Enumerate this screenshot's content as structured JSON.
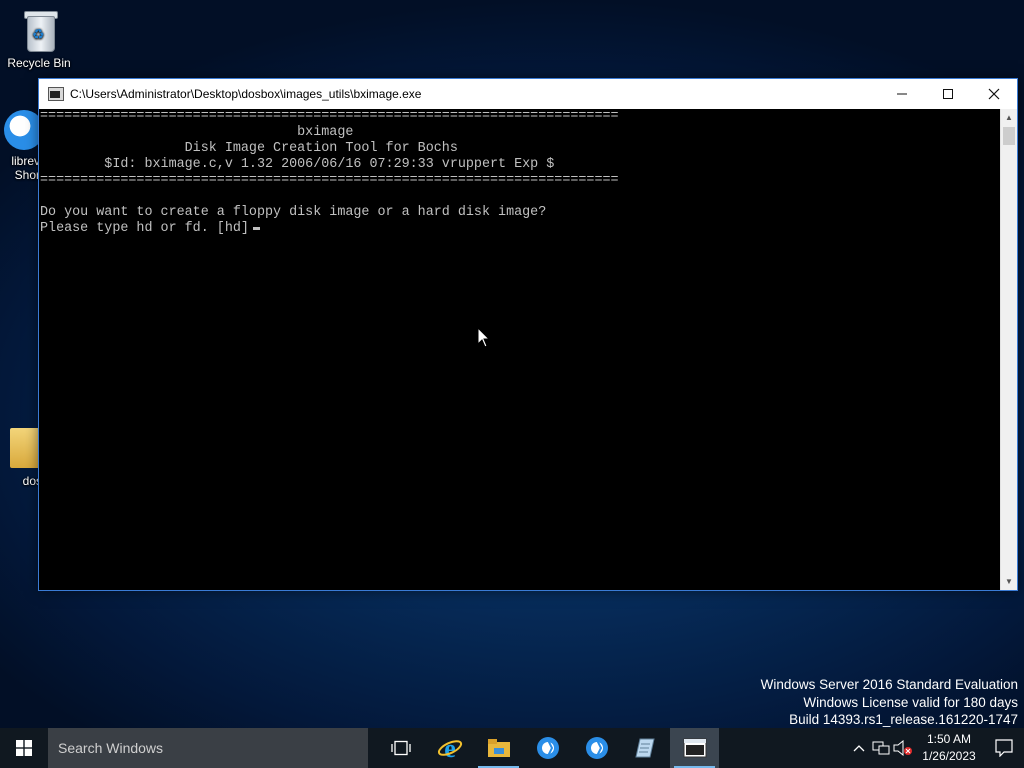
{
  "desktop": {
    "icons": [
      {
        "label": "Recycle Bin"
      },
      {
        "label_line1": "librev",
        "label_line2": "Shor"
      },
      {
        "label": "dos"
      }
    ]
  },
  "console": {
    "title": "C:\\Users\\Administrator\\Desktop\\dosbox\\images_utils\\bximage.exe",
    "output": "========================================================================\n                                bximage\n                  Disk Image Creation Tool for Bochs\n        $Id: bximage.c,v 1.32 2006/06/16 07:29:33 vruppert Exp $\n========================================================================\n\nDo you want to create a floppy disk image or a hard disk image?\nPlease type hd or fd. [hd]",
    "buttons": {
      "minimize": "minimize",
      "maximize": "maximize",
      "close": "close"
    }
  },
  "watermark": {
    "line1": "Windows Server 2016 Standard Evaluation",
    "line2": "Windows License valid for 180 days",
    "line3": "Build 14393.rs1_release.161220-1747"
  },
  "taskbar": {
    "search_placeholder": "Search Windows",
    "apps": [
      "task-view-icon",
      "internet-explorer-icon",
      "file-explorer-icon",
      "librewolf-icon",
      "librewolf-icon",
      "notepad-icon",
      "console-icon"
    ],
    "clock": {
      "time": "1:50 AM",
      "date": "1/26/2023"
    }
  },
  "colors": {
    "accent": "#3a7bd5",
    "console_bg": "#000000",
    "console_fg": "#c0c0c0",
    "taskbar_bg": "#101820"
  }
}
